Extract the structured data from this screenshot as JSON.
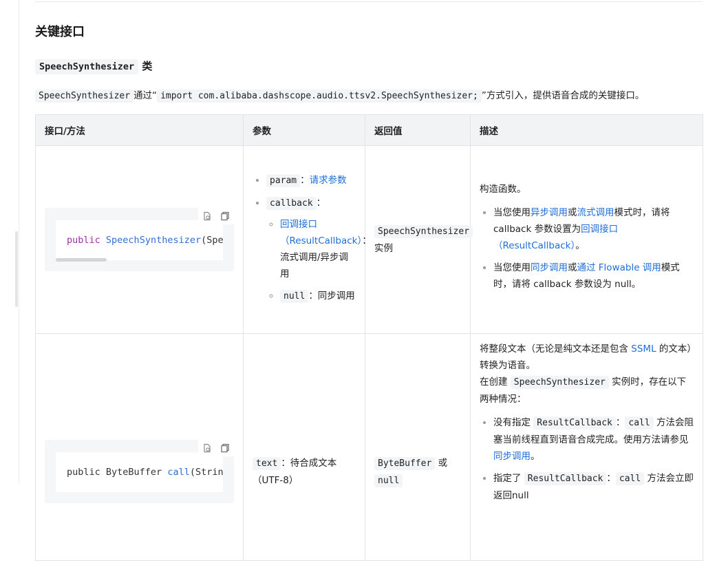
{
  "section_title": "关键接口",
  "class_heading": {
    "code": "SpeechSynthesizer",
    "suffix": "类"
  },
  "intro": {
    "code1": "SpeechSynthesizer",
    "t1": "通过“",
    "code2": "import com.alibaba.dashscope.audio.ttsv2.SpeechSynthesizer;",
    "t2": "”方式引入，提供语音合成的关键接口。"
  },
  "table": {
    "headers": [
      "接口/方法",
      "参数",
      "返回值",
      "描述"
    ],
    "row1": {
      "code": {
        "kw": "public",
        "fn": "SpeechSynthesizer",
        "rest": "(SpeechSynthesisParam param, ResultCallback<SpeechSynthesisResult> callback)"
      },
      "params": {
        "p1_code": "param",
        "p1_sep": "：",
        "p1_link": "请求参数",
        "p2_code": "callback",
        "p2_sep": "：",
        "sub1_link": "回调接口（ResultCallback）",
        "sub1_text": "：流式调用/异步调用",
        "sub2_code": "null",
        "sub2_text": "：同步调用"
      },
      "returns": {
        "code": "SpeechSynthesizer",
        "text": "实例"
      },
      "desc": {
        "intro": "构造函数。",
        "b1_t1": "当您使用",
        "b1_l1": "异步调用",
        "b1_t2": "或",
        "b1_l2": "流式调用",
        "b1_t3": "模式时，请将 callback 参数设置为",
        "b1_l3": "回调接口（ResultCallback）",
        "b1_t4": "。",
        "b2_t1": "当您使用",
        "b2_l1": "同步调用",
        "b2_t2": "或",
        "b2_l2": "通过 Flowable 调用",
        "b2_t3": "模式时，请将 callback 参数设为 null。"
      }
    },
    "row2": {
      "code": {
        "plain": "public ByteBuffer ",
        "fn": "call",
        "rest": "(String text)"
      },
      "params": {
        "code": "text",
        "text": "：待合成文本（UTF-8）"
      },
      "returns": {
        "code1": "ByteBuffer",
        "t": "或",
        "code2": "null"
      },
      "desc": {
        "p1_t1": "将整段文本（无论是纯文本还是包含",
        "p1_link": "SSML",
        "p1_t2": "的文本）转换为语音。",
        "p2_t1": "在创建",
        "p2_code": "SpeechSynthesizer",
        "p2_t2": "实例时，存在以下两种情况：",
        "b1_t1": "没有指定",
        "b1_code1": "ResultCallback",
        "b1_t2": "：",
        "b1_code2": "call",
        "b1_t3": "方法会阻塞当前线程直到语音合成完成。使用方法请参见",
        "b1_link": "同步调用",
        "b1_t4": "。",
        "b2_t1": "指定了",
        "b2_code1": "ResultCallback",
        "b2_t2": "：",
        "b2_code2": "call",
        "b2_t3": "方法会立即返回null"
      }
    }
  },
  "icons": {
    "run": "run-code-icon",
    "copy": "copy-icon"
  }
}
